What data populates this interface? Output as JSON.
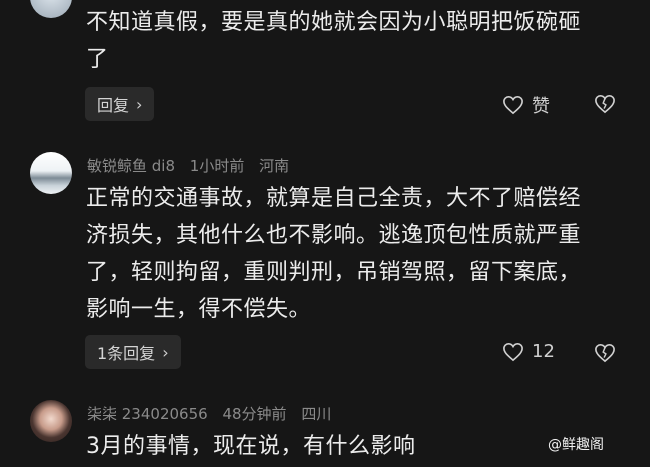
{
  "comments": [
    {
      "text_lines": [
        "不知道真假，要是真的她就会因为小聪明把饭碗砸",
        "了"
      ],
      "reply_label": "回复",
      "like_label": "赞"
    },
    {
      "username": "敏锐鲸鱼 di8",
      "time": "1小时前",
      "location": "河南",
      "text_lines": [
        "正常的交通事故，就算是自己全责，大不了赔偿经",
        "济损失，其他什么也不影响。逃逸顶包性质就严重",
        "了，轻则拘留，重则判刑，吊销驾照，留下案底，",
        "影响一生，得不偿失。"
      ],
      "reply_label": "1条回复",
      "like_count": "12"
    },
    {
      "username": "柒柒 234020656",
      "time": "48分钟前",
      "location": "四川",
      "text_lines": [
        "3月的事情，现在说，有什么影响"
      ]
    }
  ],
  "watermark": "@鲜趣阁",
  "icons": {
    "reply_chevron": "chevron-right-icon",
    "like": "heart-icon",
    "dislike": "broken-heart-icon"
  }
}
